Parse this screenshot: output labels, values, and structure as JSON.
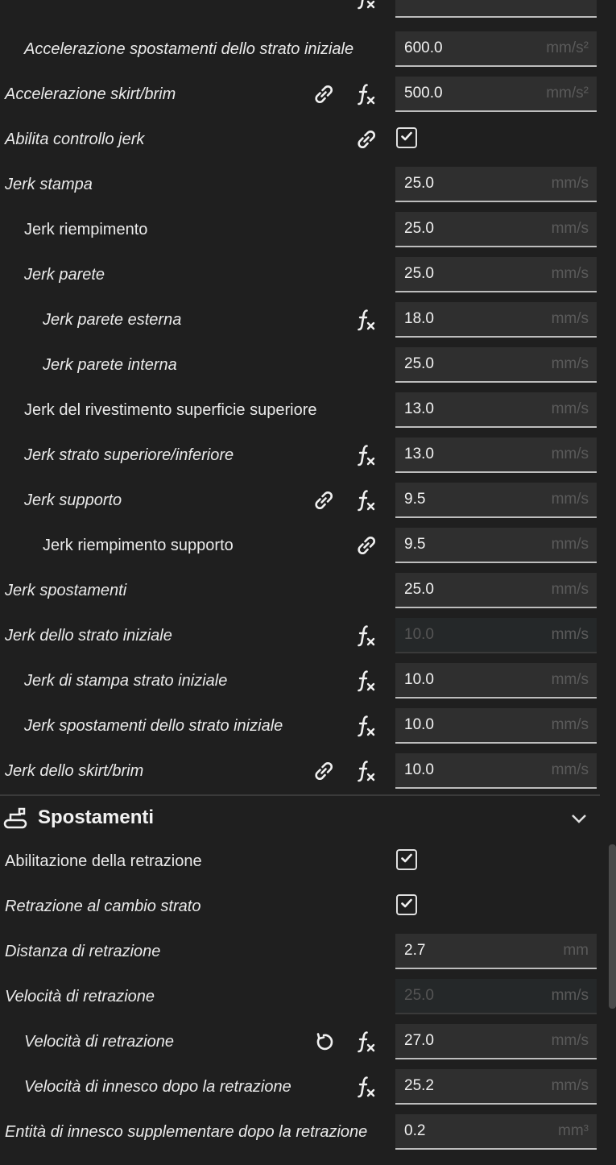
{
  "section": {
    "title": "Spostamenti"
  },
  "rows_top": [
    {
      "label": "",
      "value": "",
      "unit": "",
      "indent": 0,
      "italic": true,
      "icons": [
        "fx"
      ],
      "control": "field",
      "partial": true
    },
    {
      "label": "Accelerazione spostamenti dello strato iniziale",
      "value": "600.0",
      "unit": "mm/s²",
      "indent": 1,
      "italic": true,
      "icons": [],
      "control": "field"
    },
    {
      "label": "Accelerazione skirt/brim",
      "value": "500.0",
      "unit": "mm/s²",
      "indent": 0,
      "italic": true,
      "icons": [
        "link",
        "fx"
      ],
      "control": "field"
    },
    {
      "label": "Abilita controllo jerk",
      "indent": 0,
      "italic": true,
      "icons": [
        "link2"
      ],
      "control": "check",
      "checked": true
    },
    {
      "label": "Jerk stampa",
      "value": "25.0",
      "unit": "mm/s",
      "indent": 0,
      "italic": true,
      "icons": [],
      "control": "field"
    },
    {
      "label": "Jerk riempimento",
      "value": "25.0",
      "unit": "mm/s",
      "indent": 1,
      "italic": false,
      "icons": [],
      "control": "field"
    },
    {
      "label": "Jerk parete",
      "value": "25.0",
      "unit": "mm/s",
      "indent": 1,
      "italic": true,
      "icons": [],
      "control": "field"
    },
    {
      "label": "Jerk parete esterna",
      "value": "18.0",
      "unit": "mm/s",
      "indent": 2,
      "italic": true,
      "icons": [
        "fx"
      ],
      "control": "field"
    },
    {
      "label": "Jerk parete interna",
      "value": "25.0",
      "unit": "mm/s",
      "indent": 2,
      "italic": true,
      "icons": [],
      "control": "field"
    },
    {
      "label": "Jerk del rivestimento superficie superiore",
      "value": "13.0",
      "unit": "mm/s",
      "indent": 1,
      "italic": false,
      "icons": [],
      "control": "field"
    },
    {
      "label": "Jerk strato superiore/inferiore",
      "value": "13.0",
      "unit": "mm/s",
      "indent": 1,
      "italic": true,
      "icons": [
        "fx"
      ],
      "control": "field"
    },
    {
      "label": "Jerk supporto",
      "value": "9.5",
      "unit": "mm/s",
      "indent": 1,
      "italic": true,
      "icons": [
        "link",
        "fx"
      ],
      "control": "field"
    },
    {
      "label": "Jerk riempimento supporto",
      "value": "9.5",
      "unit": "mm/s",
      "indent": 2,
      "italic": false,
      "icons": [
        "link2"
      ],
      "control": "field"
    },
    {
      "label": "Jerk spostamenti",
      "value": "25.0",
      "unit": "mm/s",
      "indent": 0,
      "italic": true,
      "icons": [],
      "control": "field"
    },
    {
      "label": "Jerk dello strato iniziale",
      "value": "10.0",
      "unit": "mm/s",
      "indent": 0,
      "italic": true,
      "icons": [
        "fx"
      ],
      "control": "field",
      "disabled": true
    },
    {
      "label": "Jerk di stampa strato iniziale",
      "value": "10.0",
      "unit": "mm/s",
      "indent": 1,
      "italic": true,
      "icons": [
        "fx"
      ],
      "control": "field"
    },
    {
      "label": "Jerk spostamenti dello strato iniziale",
      "value": "10.0",
      "unit": "mm/s",
      "indent": 1,
      "italic": true,
      "icons": [
        "fx"
      ],
      "control": "field"
    },
    {
      "label": "Jerk dello skirt/brim",
      "value": "10.0",
      "unit": "mm/s",
      "indent": 0,
      "italic": true,
      "icons": [
        "link",
        "fx"
      ],
      "control": "field"
    }
  ],
  "rows_bottom": [
    {
      "label": "Abilitazione della retrazione",
      "indent": 0,
      "italic": false,
      "icons": [],
      "control": "check",
      "checked": true
    },
    {
      "label": "Retrazione al cambio strato",
      "indent": 0,
      "italic": true,
      "icons": [],
      "control": "check",
      "checked": true
    },
    {
      "label": "Distanza di retrazione",
      "value": "2.7",
      "unit": "mm",
      "indent": 0,
      "italic": true,
      "icons": [],
      "control": "field"
    },
    {
      "label": "Velocità di retrazione",
      "value": "25.0",
      "unit": "mm/s",
      "indent": 0,
      "italic": true,
      "icons": [],
      "control": "field",
      "disabled": true
    },
    {
      "label": "Velocità di retrazione",
      "value": "27.0",
      "unit": "mm/s",
      "indent": 1,
      "italic": true,
      "icons": [
        "reset",
        "fx"
      ],
      "control": "field"
    },
    {
      "label": "Velocità di innesco dopo la retrazione",
      "value": "25.2",
      "unit": "mm/s",
      "indent": 1,
      "italic": true,
      "icons": [
        "fx"
      ],
      "control": "field"
    },
    {
      "label": "Entità di innesco supplementare dopo la retrazione",
      "value": "0.2",
      "unit": "mm³",
      "indent": 0,
      "italic": true,
      "icons": [],
      "control": "field"
    }
  ],
  "icons": {
    "link": "link-icon",
    "link2": "link-icon",
    "fx": "function-icon",
    "reset": "reset-icon",
    "check": "checkmark-icon",
    "section": "travel-icon",
    "chevron": "chevron-down-icon"
  }
}
